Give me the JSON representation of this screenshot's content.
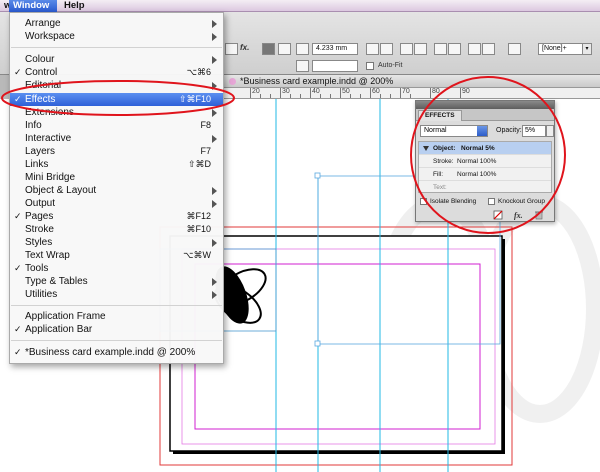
{
  "menubar": {
    "items": [
      {
        "label": "w"
      },
      {
        "label": "Window"
      },
      {
        "label": "Help"
      }
    ]
  },
  "controls": {
    "measure_value": "4.233 mm",
    "auto_fit_label": "Auto-Fit",
    "style_select": "[None]+",
    "fx_label": "fx."
  },
  "document": {
    "tab_title": "*Business card example.indd @ 200%"
  },
  "ruler": {
    "labels": [
      "20",
      "30",
      "40",
      "50",
      "60",
      "70",
      "80",
      "90"
    ]
  },
  "window_menu": {
    "items": [
      {
        "label": "Arrange",
        "checked": false,
        "shortcut": "",
        "submenu": true
      },
      {
        "label": "Workspace",
        "checked": false,
        "shortcut": "",
        "submenu": true
      },
      {
        "sep": true
      },
      {
        "label": "Colour",
        "checked": false,
        "shortcut": "",
        "submenu": true
      },
      {
        "label": "Control",
        "checked": true,
        "shortcut": "⌥⌘6",
        "submenu": false
      },
      {
        "label": "Editorial",
        "checked": false,
        "shortcut": "",
        "submenu": true
      },
      {
        "label": "Effects",
        "checked": true,
        "shortcut": "⇧⌘F10",
        "submenu": false,
        "highlighted": true
      },
      {
        "label": "Extensions",
        "checked": false,
        "shortcut": "",
        "submenu": true
      },
      {
        "label": "Info",
        "checked": false,
        "shortcut": "F8",
        "submenu": false
      },
      {
        "label": "Interactive",
        "checked": false,
        "shortcut": "",
        "submenu": true
      },
      {
        "label": "Layers",
        "checked": false,
        "shortcut": "F7",
        "submenu": false
      },
      {
        "label": "Links",
        "checked": false,
        "shortcut": "⇧⌘D",
        "submenu": false
      },
      {
        "label": "Mini Bridge",
        "checked": false,
        "shortcut": "",
        "submenu": false
      },
      {
        "label": "Object & Layout",
        "checked": false,
        "shortcut": "",
        "submenu": true
      },
      {
        "label": "Output",
        "checked": false,
        "shortcut": "",
        "submenu": true
      },
      {
        "label": "Pages",
        "checked": true,
        "shortcut": "⌘F12",
        "submenu": false
      },
      {
        "label": "Stroke",
        "checked": false,
        "shortcut": "⌘F10",
        "submenu": false
      },
      {
        "label": "Styles",
        "checked": false,
        "shortcut": "",
        "submenu": true
      },
      {
        "label": "Text Wrap",
        "checked": false,
        "shortcut": "⌥⌘W",
        "submenu": false
      },
      {
        "label": "Tools",
        "checked": true,
        "shortcut": "",
        "submenu": false
      },
      {
        "label": "Type & Tables",
        "checked": false,
        "shortcut": "",
        "submenu": true
      },
      {
        "label": "Utilities",
        "checked": false,
        "shortcut": "",
        "submenu": true
      },
      {
        "sep": true
      },
      {
        "label": "Application Frame",
        "checked": false,
        "shortcut": "",
        "submenu": false
      },
      {
        "label": "Application Bar",
        "checked": true,
        "shortcut": "",
        "submenu": false
      },
      {
        "sep": true
      },
      {
        "label": "*Business card example.indd @ 200%",
        "checked": true,
        "shortcut": "",
        "submenu": false
      }
    ]
  },
  "effects_panel": {
    "tab_label": "EFFECTS",
    "blend_mode": "Normal",
    "opacity_label": "Opacity:",
    "opacity_value": "5%",
    "targets": [
      {
        "label": "Object:",
        "value": "Normal 5%"
      },
      {
        "label": "Stroke:",
        "value": "Normal 100%"
      },
      {
        "label": "Fill:",
        "value": "Normal 100%"
      },
      {
        "label": "Text:",
        "value": ""
      }
    ],
    "isolate_label": "Isolate Blending",
    "knockout_label": "Knockout Group"
  },
  "colors": {
    "highlight": "#3a6be0",
    "annotation": "#e0141c",
    "guides": "#22b8e6",
    "margins": "#d21fd2",
    "bleed": "#e23a3a"
  }
}
